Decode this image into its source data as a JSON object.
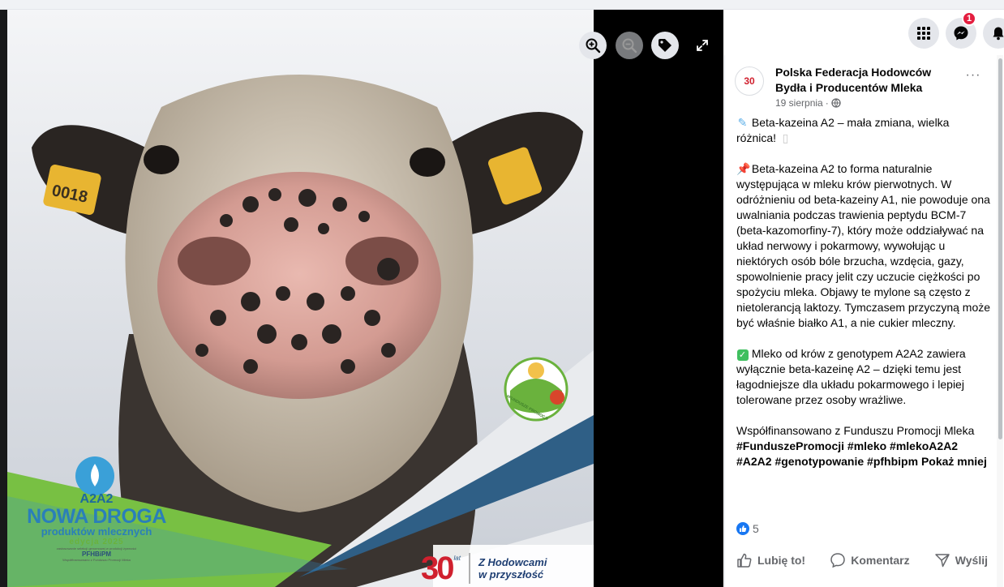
{
  "viewer": {
    "controls": {
      "zoom_in": "zoom-in-icon",
      "zoom_out": "zoom-out-icon",
      "tag": "tag-icon",
      "fullscreen": "expand-icon"
    },
    "image": {
      "ear_tag": "0018",
      "badge": {
        "line1": "A2A2",
        "line2": "NOWA DROGA",
        "line3": "produktów mlecznych",
        "line4": "edycja 2025",
        "line5": "zastosowanie selekcji genomowej w produkcji żywności",
        "line6": "PFHBiPM",
        "line7": "Współfinansowano z Funduszu Promocji Mleka"
      },
      "fundusze_label": "#FUNDUSZE PROMOCJI",
      "logo_number": "30",
      "logo_lat": "lat",
      "slogan_line1": "Z Hodowcami",
      "slogan_line2": "w przyszłość"
    }
  },
  "header": {
    "notification_count": "1",
    "menu_icon": "grid-menu-icon",
    "messenger_icon": "messenger-icon",
    "bell_icon": "bell-icon"
  },
  "post": {
    "avatar_text": "30",
    "author": "Polska Federacja Hodowców Bydła i Producentów Mleka",
    "date": "19 sierpnia",
    "separator": "·",
    "more_label": "···",
    "paragraphs": {
      "p1": "Beta-kazeina A2 – mała zmiana, wielka różnica!",
      "p2": "Beta-kazeina A2 to forma naturalnie występująca w mleku krów pierwotnych. W odróżnieniu od beta-kazeiny A1, nie powoduje ona uwalniania podczas trawienia peptydu BCM-7 (beta-kazomorfiny-7), który może oddziaływać na układ nerwowy i pokarmowy, wywołując u niektórych osób bóle brzucha, wzdęcia, gazy, spowolnienie pracy jelit czy uczucie ciężkości po spożyciu mleka. Objawy te mylone są często z nietolerancją laktozy. Tymczasem przyczyną może być właśnie białko A1, a nie cukier mleczny.",
      "p3": "Mleko od krów z genotypem A2A2 zawiera wyłącznie beta-kazeinę A2 – dzięki temu jest łagodniejsze dla układu pokarmowego i lepiej tolerowane przez osoby wrażliwe.",
      "p4": "Współfinansowano z Funduszu Promocji Mleka",
      "hashtags": "#FunduszePromocji #mleko #mlekoA2A2 #A2A2 #genotypowanie #pfhbipm",
      "show_less": "Pokaż mniej"
    },
    "reaction_count": "5",
    "actions": {
      "like": "Lubię to!",
      "comment": "Komentarz",
      "share": "Wyślij"
    }
  }
}
